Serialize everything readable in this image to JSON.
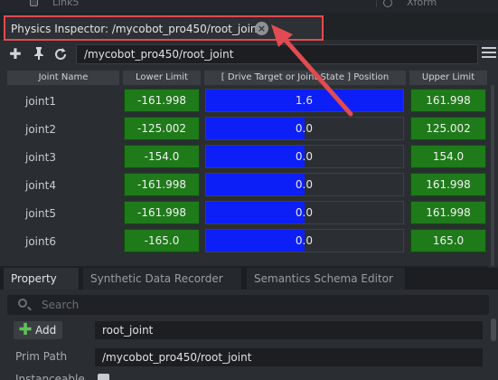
{
  "stage": {
    "item_label": "Link5",
    "right_label": "Xform"
  },
  "inspector": {
    "title": "Physics Inspector: /mycobot_pro450/root_joint",
    "close_glyph": "×",
    "path": "/mycobot_pro450/root_joint",
    "headers": {
      "name": "Joint Name",
      "lower": "Lower Limit",
      "drive": "[ Drive Target or Joint State ] Position",
      "upper": "Upper Limit"
    },
    "joints": [
      {
        "name": "joint1",
        "lower": "-161.998",
        "value": "1.6",
        "fill": 1.0,
        "upper": "161.998"
      },
      {
        "name": "joint2",
        "lower": "-125.002",
        "value": "0.0",
        "fill": 0.5,
        "upper": "125.002"
      },
      {
        "name": "joint3",
        "lower": "-154.0",
        "value": "0.0",
        "fill": 0.5,
        "upper": "154.0"
      },
      {
        "name": "joint4",
        "lower": "-161.998",
        "value": "0.0",
        "fill": 0.5,
        "upper": "161.998"
      },
      {
        "name": "joint5",
        "lower": "-161.998",
        "value": "0.0",
        "fill": 0.5,
        "upper": "161.998"
      },
      {
        "name": "joint6",
        "lower": "-165.0",
        "value": "0.0",
        "fill": 0.5,
        "upper": "165.0"
      }
    ],
    "colors": {
      "limit_bg": "#1f7a1a",
      "drive_fill": "#0d1ff7",
      "highlight": "#e24b51"
    }
  },
  "property": {
    "tabs": [
      "Property",
      "Synthetic Data Recorder",
      "Semantics Schema Editor"
    ],
    "search_placeholder": "Search",
    "add_label": "Add",
    "name_value": "root_joint",
    "prim_path_label": "Prim Path",
    "prim_path_value": "/mycobot_pro450/root_joint",
    "instanceable_label": "Instanceable"
  }
}
